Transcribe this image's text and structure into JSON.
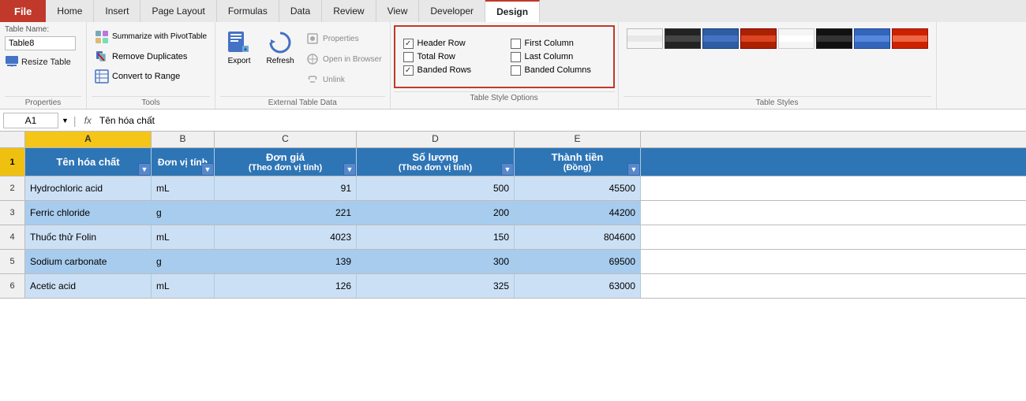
{
  "tabs": {
    "file": "File",
    "home": "Home",
    "insert": "Insert",
    "pageLayout": "Page Layout",
    "formulas": "Formulas",
    "data": "Data",
    "review": "Review",
    "view": "View",
    "developer": "Developer",
    "design": "Design"
  },
  "ribbon": {
    "groups": {
      "properties": {
        "label": "Properties",
        "tableNameLabel": "Table Name:",
        "tableNameValue": "Table8",
        "resizeTable": "Resize Table"
      },
      "tools": {
        "label": "Tools",
        "summarize": "Summarize with PivotTable",
        "removeDuplicates": "Remove Duplicates",
        "convertToRange": "Convert to Range"
      },
      "externalTableData": {
        "label": "External Table Data",
        "export": "Export",
        "refresh": "Refresh",
        "properties": "Properties",
        "openInBrowser": "Open in Browser",
        "unlink": "Unlink"
      },
      "tableStyleOptions": {
        "label": "Table Style Options",
        "headerRow": "Header Row",
        "totalRow": "Total Row",
        "bandedRows": "Banded Rows",
        "firstColumn": "First Column",
        "lastColumn": "Last Column",
        "bandedColumns": "Banded Columns",
        "headerRowChecked": true,
        "totalRowChecked": false,
        "bandedRowsChecked": true,
        "firstColumnChecked": false,
        "lastColumnChecked": false,
        "bandedColumnsChecked": false
      },
      "tableStyles": {
        "label": "Table Styles"
      }
    }
  },
  "formulaBar": {
    "cellRef": "A1",
    "formula": "Tên hóa chất"
  },
  "columnLetters": [
    "A",
    "B",
    "C",
    "D",
    "E"
  ],
  "headers": [
    "Tên hóa chất",
    "Đơn vị tính",
    "Đơn giá\n(Theo đơn vị tính)",
    "Số lượng\n(Theo đơn vị tính)",
    "Thành tiền\n(Đồng)"
  ],
  "rows": [
    {
      "num": 2,
      "a": "Hydrochloric acid",
      "b": "mL",
      "c": "91",
      "d": "500",
      "e": "45500"
    },
    {
      "num": 3,
      "a": "Ferric chloride",
      "b": "g",
      "c": "221",
      "d": "200",
      "e": "44200"
    },
    {
      "num": 4,
      "a": "Thuốc thử Folin",
      "b": "mL",
      "c": "4023",
      "d": "150",
      "e": "804600"
    },
    {
      "num": 5,
      "a": "Sodium carbonate",
      "b": "g",
      "c": "139",
      "d": "300",
      "e": "69500"
    },
    {
      "num": 6,
      "a": "Acetic acid",
      "b": "mL",
      "c": "126",
      "d": "325",
      "e": "63000"
    }
  ]
}
